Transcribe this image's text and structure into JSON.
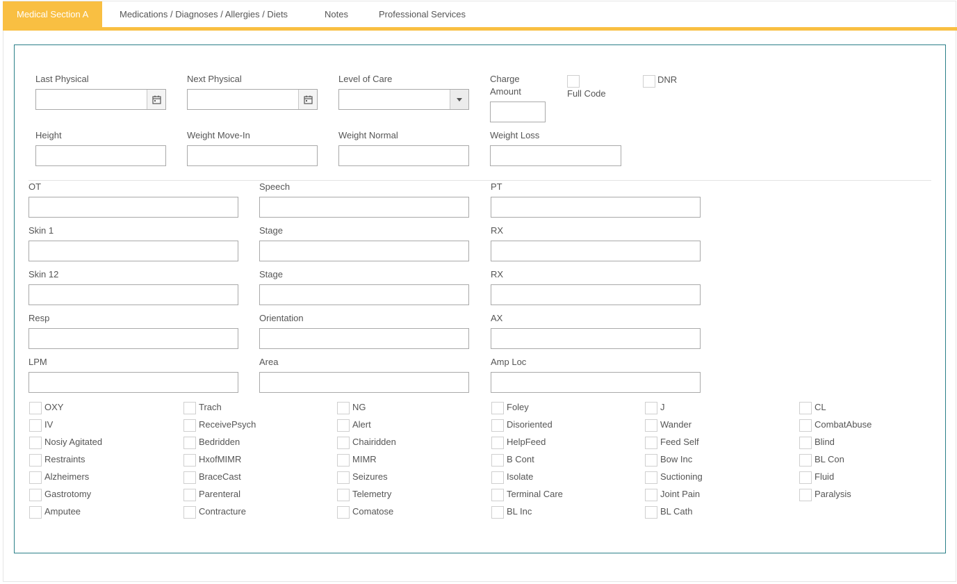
{
  "tabs": [
    {
      "label": "Medical Section A",
      "active": true
    },
    {
      "label": "Medications / Diagnoses / Allergies / Diets",
      "active": false
    },
    {
      "label": "Notes",
      "active": false
    },
    {
      "label": "Professional Services",
      "active": false
    }
  ],
  "colors": {
    "accent": "#f9bf42",
    "panel_border": "#2a7f88"
  },
  "fields": {
    "last_physical": {
      "label": "Last Physical",
      "value": ""
    },
    "next_physical": {
      "label": "Next Physical",
      "value": ""
    },
    "level_of_care": {
      "label": "Level of Care",
      "value": ""
    },
    "charge_amount": {
      "label_line1": "Charge",
      "label_line2": "Amount",
      "value": ""
    },
    "full_code": {
      "label": "Full Code",
      "checked": false
    },
    "dnr": {
      "label": "DNR",
      "checked": false
    },
    "height": {
      "label": "Height",
      "value": ""
    },
    "weight_move_in": {
      "label": "Weight Move-In",
      "value": ""
    },
    "weight_normal": {
      "label": "Weight Normal",
      "value": ""
    },
    "weight_loss": {
      "label": "Weight Loss",
      "value": ""
    }
  },
  "grid_fields": [
    [
      {
        "label": "OT",
        "value": ""
      },
      {
        "label": "Speech",
        "value": ""
      },
      {
        "label": "PT",
        "value": ""
      }
    ],
    [
      {
        "label": "Skin 1",
        "value": ""
      },
      {
        "label": "Stage",
        "value": ""
      },
      {
        "label": "RX",
        "value": ""
      }
    ],
    [
      {
        "label": "Skin 12",
        "value": ""
      },
      {
        "label": "Stage",
        "value": ""
      },
      {
        "label": "RX",
        "value": ""
      }
    ],
    [
      {
        "label": "Resp",
        "value": ""
      },
      {
        "label": "Orientation",
        "value": ""
      },
      {
        "label": "AX",
        "value": ""
      }
    ],
    [
      {
        "label": "LPM",
        "value": ""
      },
      {
        "label": "Area",
        "value": ""
      },
      {
        "label": "Amp Loc",
        "value": ""
      }
    ]
  ],
  "checkbox_columns": [
    [
      "OXY",
      "IV",
      "Nosiy Agitated",
      "Restraints",
      "Alzheimers",
      "Gastrotomy",
      "Amputee"
    ],
    [
      "Trach",
      "ReceivePsych",
      "Bedridden",
      "HxofMIMR",
      "BraceCast",
      "Parenteral",
      "Contracture"
    ],
    [
      "NG",
      "Alert",
      "Chairidden",
      "MIMR",
      "Seizures",
      "Telemetry",
      "Comatose"
    ],
    [
      "Foley",
      "Disoriented",
      "HelpFeed",
      "B Cont",
      "Isolate",
      "Terminal Care",
      "BL Inc"
    ],
    [
      "J",
      "Wander",
      "Feed Self",
      "Bow Inc",
      "Suctioning",
      "Joint Pain",
      "BL Cath"
    ],
    [
      "CL",
      "CombatAbuse",
      "Blind",
      "BL Con",
      "Fluid",
      "Paralysis"
    ]
  ],
  "icons": {
    "calendar": "calendar-icon",
    "dropdown": "chevron-down-icon"
  }
}
